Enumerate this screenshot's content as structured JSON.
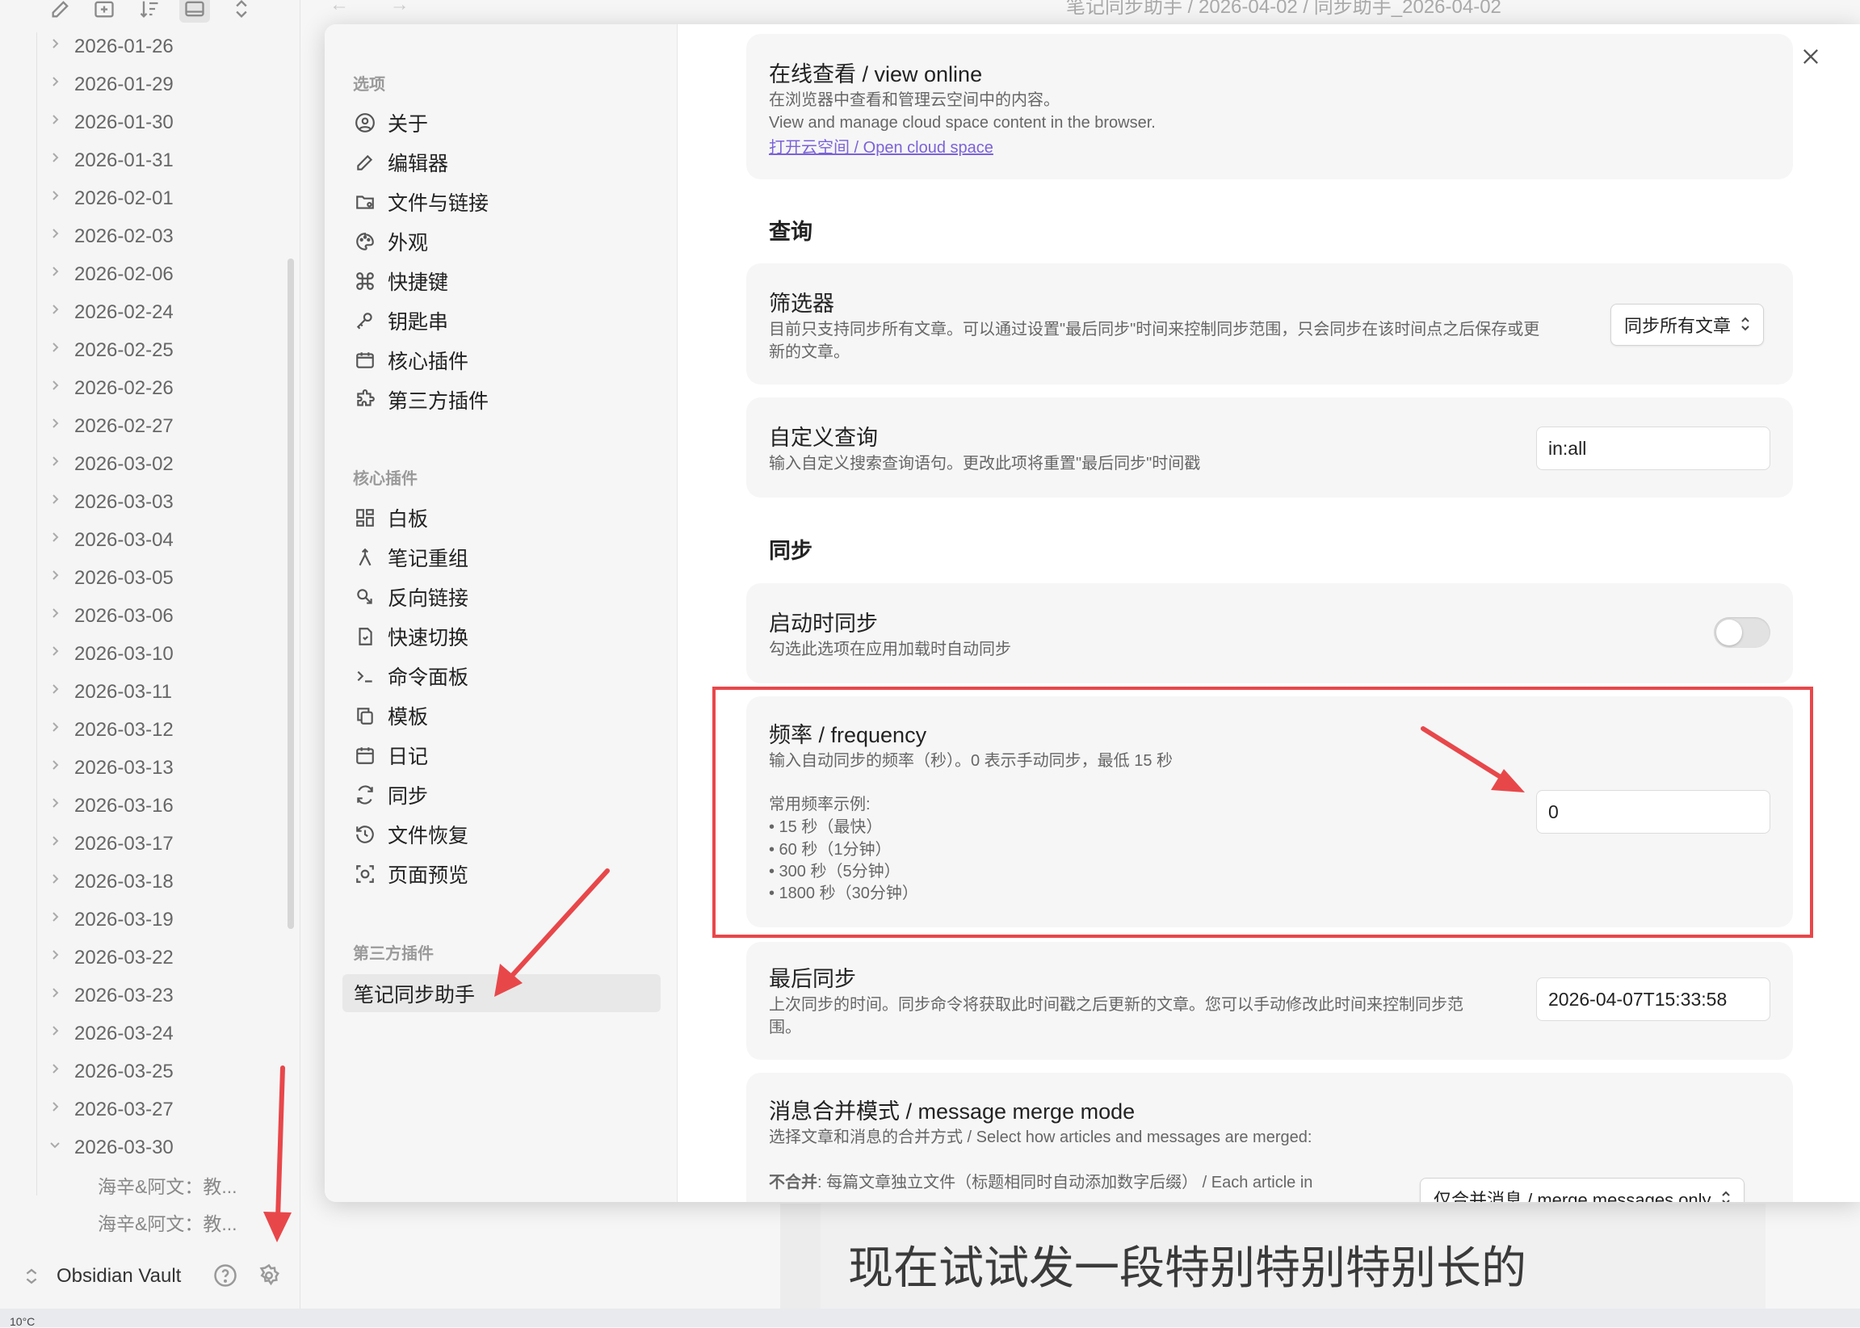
{
  "explorer": {
    "folders": [
      "2026-01-26",
      "2026-01-29",
      "2026-01-30",
      "2026-01-31",
      "2026-02-01",
      "2026-02-03",
      "2026-02-06",
      "2026-02-24",
      "2026-02-25",
      "2026-02-26",
      "2026-02-27",
      "2026-03-02",
      "2026-03-03",
      "2026-03-04",
      "2026-03-05",
      "2026-03-06",
      "2026-03-10",
      "2026-03-11",
      "2026-03-12",
      "2026-03-13",
      "2026-03-16",
      "2026-03-17",
      "2026-03-18",
      "2026-03-19",
      "2026-03-22",
      "2026-03-23",
      "2026-03-24",
      "2026-03-25",
      "2026-03-27",
      "2026-03-30"
    ],
    "expanded_folder": "2026-03-30",
    "files": [
      "海辛&阿文：教...",
      "海辛&阿文：教..."
    ],
    "vault_name": "Obsidian Vault"
  },
  "breadcrumb": "笔记同步助手 / 2026-04-02 / 同步助手_2026-04-02",
  "note_text": "现在试试发一段特别特别特别长的",
  "weather": "10°C",
  "settings": {
    "options_title": "选项",
    "options": [
      {
        "label": "关于",
        "icon": "user-circle-icon"
      },
      {
        "label": "编辑器",
        "icon": "pencil-icon"
      },
      {
        "label": "文件与链接",
        "icon": "folder-link-icon"
      },
      {
        "label": "外观",
        "icon": "palette-icon"
      },
      {
        "label": "快捷键",
        "icon": "command-icon"
      },
      {
        "label": "钥匙串",
        "icon": "key-icon"
      },
      {
        "label": "核心插件",
        "icon": "calendar-box-icon"
      },
      {
        "label": "第三方插件",
        "icon": "puzzle-icon"
      }
    ],
    "core_title": "核心插件",
    "core_plugins": [
      {
        "label": "白板",
        "icon": "grid-icon"
      },
      {
        "label": "笔记重组",
        "icon": "merge-icon"
      },
      {
        "label": "反向链接",
        "icon": "backlink-icon"
      },
      {
        "label": "快速切换",
        "icon": "file-switch-icon"
      },
      {
        "label": "命令面板",
        "icon": "terminal-icon"
      },
      {
        "label": "模板",
        "icon": "copy-icon"
      },
      {
        "label": "日记",
        "icon": "calendar-icon"
      },
      {
        "label": "同步",
        "icon": "sync-icon"
      },
      {
        "label": "文件恢复",
        "icon": "history-icon"
      },
      {
        "label": "页面预览",
        "icon": "preview-icon"
      }
    ],
    "community_title": "第三方插件",
    "community_plugins": [
      {
        "label": "笔记同步助手"
      }
    ]
  },
  "content": {
    "online": {
      "title": "在线查看 / view online",
      "desc1": "在浏览器中查看和管理云空间中的内容。",
      "desc2": "View and manage cloud space content in the browser.",
      "link": "打开云空间 / Open cloud space"
    },
    "query_heading": "查询",
    "filter": {
      "title": "筛选器",
      "desc1": "目前只支持同步所有文章。可以通过设置\"最后同步\"时间来控制同步范围，只会同步在该时间点之后保存或更",
      "desc2": "新的文章。",
      "value": "同步所有文章"
    },
    "custom_query": {
      "title": "自定义查询",
      "desc": "输入自定义搜索查询语句。更改此项将重置\"最后同步\"时间戳",
      "value": "in:all"
    },
    "sync_heading": "同步",
    "sync_on_start": {
      "title": "启动时同步",
      "desc": "勾选此选项在应用加载时自动同步",
      "enabled": false
    },
    "frequency": {
      "title": "频率 / frequency",
      "desc": "输入自动同步的频率（秒）。0 表示手动同步，最低 15 秒",
      "examples_title": "常用频率示例:",
      "examples": [
        "• 15 秒（最快）",
        "• 60 秒（1分钟）",
        "• 300 秒（5分钟）",
        "• 1800 秒（30分钟）"
      ],
      "value": "0"
    },
    "last_sync": {
      "title": "最后同步",
      "desc1": "上次同步的时间。同步命令将获取此时间戳之后更新的文章。您可以手动修改此时间来控制同步范",
      "desc2": "围。",
      "value": "2026-04-07T15:33:58"
    },
    "merge_mode": {
      "title": "消息合并模式 / message merge mode",
      "desc": "选择文章和消息的合并方式 / Select how articles and messages are merged:",
      "option_bold": "不合并",
      "option_text": ": 每篇文章独立文件（标题相同时自动添加数字后缀） / Each article in",
      "value": "仅合并消息 / merge messages only"
    }
  },
  "colors": {
    "highlight": "#e8474a",
    "accent_link": "#7b62d8"
  }
}
